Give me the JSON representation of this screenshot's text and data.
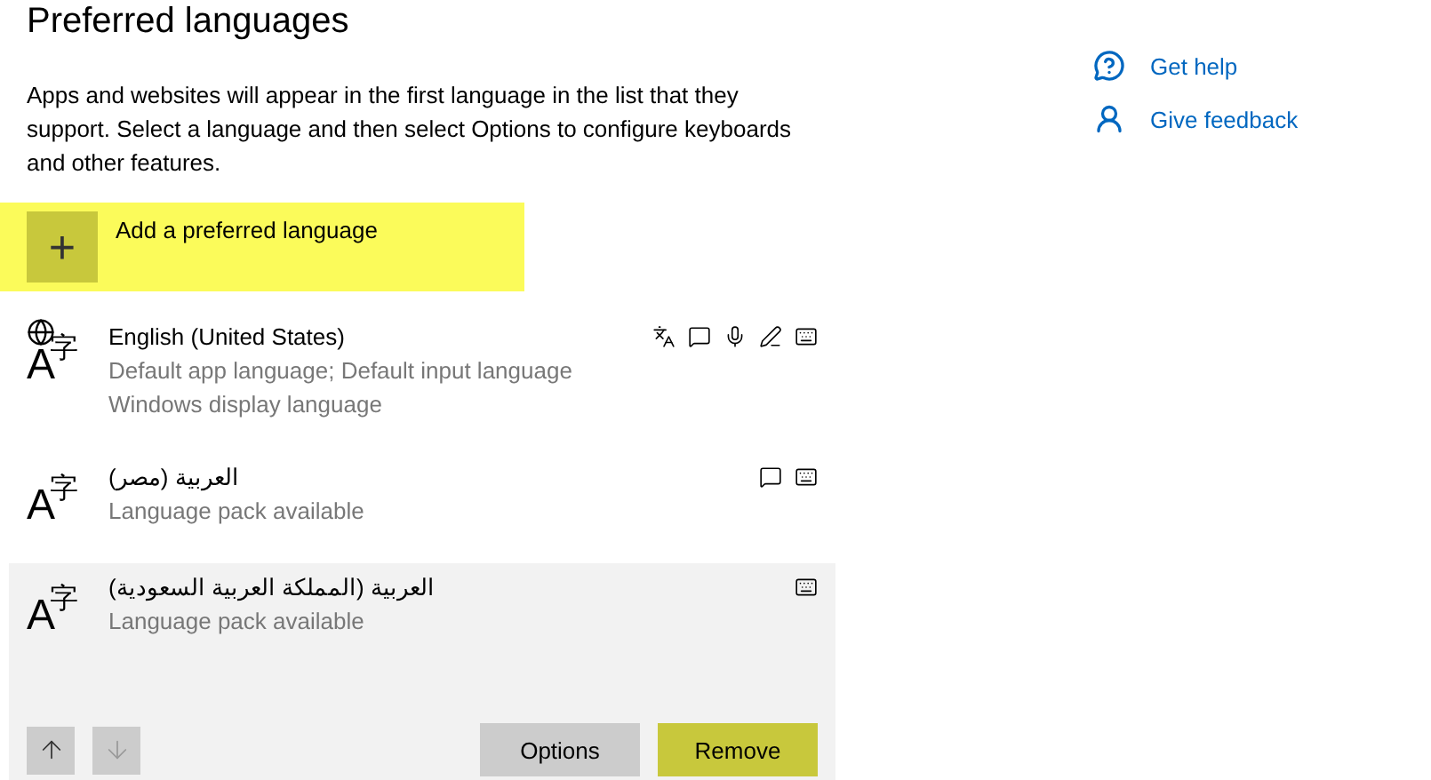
{
  "title": "Preferred languages",
  "description": "Apps and websites will appear in the first language in the list that they support. Select a language and then select Options to configure keyboards and other features.",
  "add_button": {
    "label": "Add a preferred language",
    "icon": "+",
    "highlighted": true
  },
  "languages": [
    {
      "name": "English (United States)",
      "icon_letters": [
        "A",
        "字"
      ],
      "globe": true,
      "details": [
        "Default app language; Default input language",
        "Windows display language"
      ],
      "features": [
        {
          "kind": "text"
        },
        {
          "kind": "display"
        },
        {
          "kind": "speech"
        },
        {
          "kind": "handwriting"
        },
        {
          "kind": "keyboard"
        }
      ],
      "selected": false
    },
    {
      "name": "العربية (مصر)",
      "icon_letters": [
        "A",
        "字"
      ],
      "globe": false,
      "details": [
        "Language pack available"
      ],
      "features": [
        {
          "kind": "display"
        },
        {
          "kind": "keyboard"
        }
      ],
      "selected": false
    },
    {
      "name": "العربية (المملكة العربية السعودية)",
      "icon_letters": [
        "A",
        "字"
      ],
      "globe": false,
      "details": [
        "Language pack available"
      ],
      "features": [
        {
          "kind": "keyboard"
        }
      ],
      "selected": true
    }
  ],
  "row_actions": {
    "move_up": {
      "disabled": false
    },
    "move_down": {
      "disabled": true
    },
    "buttons": [
      {
        "label": "Options",
        "highlighted": false
      },
      {
        "label": "Remove",
        "highlighted": true
      }
    ]
  },
  "links": [
    {
      "label": "Get help",
      "kind": "help"
    },
    {
      "label": "Give feedback",
      "kind": "feedback"
    }
  ]
}
